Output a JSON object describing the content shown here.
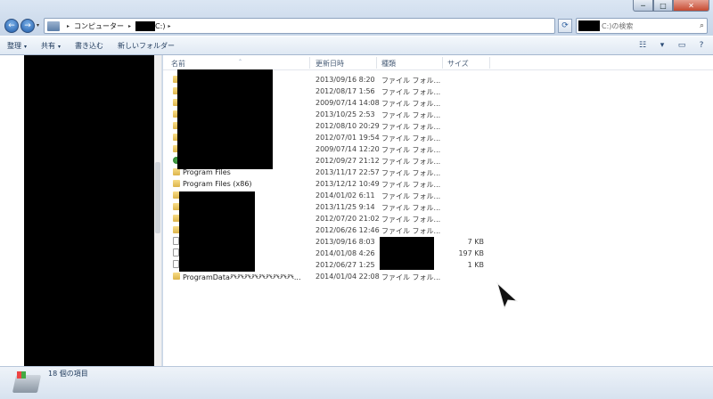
{
  "window": {
    "controls": {
      "minimize": "─",
      "maximize": "□",
      "close": "✕"
    }
  },
  "nav": {
    "back_glyph": "←",
    "forward_glyph": "→",
    "drop_glyph": "▾"
  },
  "address": {
    "crumbs_sep": "▸",
    "crumb_1": "コンピューター",
    "crumb_2_tail": "C:)",
    "end_sep": "▸"
  },
  "refresh_glyph": "⟳",
  "search": {
    "placeholder_tail": "C:)の検索",
    "icon_glyph": "⌕"
  },
  "commands": [
    {
      "label": "整理",
      "dropdown": true
    },
    {
      "label": "共有",
      "dropdown": true
    },
    {
      "label": "書き込む",
      "dropdown": false
    },
    {
      "label": "新しいフォルダー",
      "dropdown": false
    }
  ],
  "view_icons": {
    "views": "☷",
    "dd": "▾",
    "preview": "▭",
    "help": "?"
  },
  "columns": {
    "name": "名前",
    "date": "更新日時",
    "type": "種類",
    "size": "サイズ"
  },
  "files": [
    {
      "name": "",
      "date": "2013/09/16 8:20",
      "type": "ファイル フォル...",
      "size": "",
      "icon": "folder"
    },
    {
      "name": "",
      "date": "2012/08/17 1:56",
      "type": "ファイル フォル...",
      "size": "",
      "icon": "folder"
    },
    {
      "name": "",
      "date": "2009/07/14 14:08",
      "type": "ファイル フォル...",
      "size": "",
      "icon": "folder"
    },
    {
      "name": "",
      "date": "2013/10/25 2:53",
      "type": "ファイル フォル...",
      "size": "",
      "icon": "folder"
    },
    {
      "name": "",
      "date": "2012/08/10 20:29",
      "type": "ファイル フォル...",
      "size": "",
      "icon": "folder"
    },
    {
      "name": "",
      "date": "2012/07/01 19:54",
      "type": "ファイル フォル...",
      "size": "",
      "icon": "folder"
    },
    {
      "name": "",
      "date": "2009/07/14 12:20",
      "type": "ファイル フォル...",
      "size": "",
      "icon": "folder"
    },
    {
      "name": "",
      "date": "2012/09/27 21:12",
      "type": "ファイル フォル...",
      "size": "",
      "icon": "check"
    },
    {
      "name": "Program Files",
      "date": "2013/11/17 22:57",
      "type": "ファイル フォル...",
      "size": "",
      "icon": "folder"
    },
    {
      "name": "Program Files (x86)",
      "date": "2013/12/12 10:49",
      "type": "ファイル フォル...",
      "size": "",
      "icon": "folder"
    },
    {
      "name": "",
      "date": "2014/01/02 6:11",
      "type": "ファイル フォル...",
      "size": "",
      "icon": "folder"
    },
    {
      "name": "",
      "date": "2013/11/25 9:14",
      "type": "ファイル フォル...",
      "size": "",
      "icon": "folder"
    },
    {
      "name": "",
      "date": "2012/07/20 21:02",
      "type": "ファイル フォル...",
      "size": "",
      "icon": "folder"
    },
    {
      "name": "",
      "date": "2012/06/26 12:46",
      "type": "ファイル フォル...",
      "size": "",
      "icon": "folder"
    },
    {
      "name": "",
      "date": "2013/09/16 8:03",
      "type": "",
      "size": "7 KB",
      "icon": "file"
    },
    {
      "name": "",
      "date": "2014/01/08 4:26",
      "type": "",
      "size": "197 KB",
      "icon": "file"
    },
    {
      "name": "",
      "date": "2012/06/27 1:25",
      "type": "",
      "size": "1 KB",
      "icon": "file"
    },
    {
      "name": "ProgramData癶癶癶癶癶癶癶癶癶...",
      "date": "2014/01/04 22:08",
      "type": "ファイル フォル...",
      "size": "",
      "icon": "folder"
    }
  ],
  "status": {
    "count_text": "18 個の項目"
  }
}
